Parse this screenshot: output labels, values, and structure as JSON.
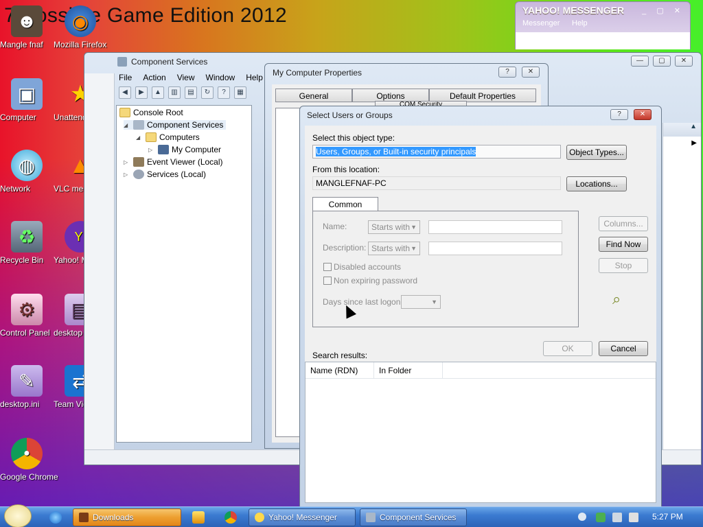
{
  "desktop": {
    "wallpaper_title": "7 Possible Game Edition 2012",
    "icons": [
      {
        "label": "Mangle fnaf",
        "icon": "mangle-icon"
      },
      {
        "label": "Mozilla Firefox",
        "icon": "firefox-icon"
      },
      {
        "label": "Computer",
        "icon": "computer-icon"
      },
      {
        "label": "Unattended Software",
        "icon": "star-icon"
      },
      {
        "label": "Network",
        "icon": "network-icon"
      },
      {
        "label": "VLC media player",
        "icon": "vlc-icon"
      },
      {
        "label": "Recycle Bin",
        "icon": "recycle-bin-icon"
      },
      {
        "label": "Yahoo! Messenger",
        "icon": "yahoo-icon"
      },
      {
        "label": "Control Panel",
        "icon": "control-panel-icon"
      },
      {
        "label": "desktop",
        "icon": "document-icon"
      },
      {
        "label": "desktop.ini",
        "icon": "settings-file-icon"
      },
      {
        "label": "Team Viewer",
        "icon": "teamviewer-icon"
      },
      {
        "label": "Google Chrome",
        "icon": "chrome-icon"
      }
    ]
  },
  "yahoo_window": {
    "title": "YAHOO! MESSENGER",
    "menu": [
      "Messenger",
      "Help"
    ]
  },
  "component_services": {
    "title": "Component Services",
    "menu": [
      "File",
      "Action",
      "View",
      "Window",
      "Help"
    ],
    "tree": [
      {
        "label": "Console Root"
      },
      {
        "label": "Component Services"
      },
      {
        "label": "Computers"
      },
      {
        "label": "My Computer"
      },
      {
        "label": "Event Viewer (Local)"
      },
      {
        "label": "Services (Local)"
      }
    ]
  },
  "my_computer_props": {
    "title": "My Computer Properties",
    "tabs": [
      "General",
      "Options",
      "Default Properties",
      "COM Security"
    ]
  },
  "select_users": {
    "title": "Select Users or Groups",
    "object_type_label": "Select this object type:",
    "object_type_value": "Users, Groups, or Built-in security principals",
    "object_types_button": "Object Types...",
    "location_label": "From this location:",
    "location_value": "MANGLEFNAF-PC",
    "locations_button": "Locations...",
    "tab": "Common Queries",
    "name_label": "Name:",
    "name_mode": "Starts with",
    "desc_label": "Description:",
    "desc_mode": "Starts with",
    "disabled_accounts": "Disabled accounts",
    "non_expiring": "Non expiring password",
    "days_label": "Days since last logon:",
    "columns_button": "Columns...",
    "find_now_button": "Find Now",
    "stop_button": "Stop",
    "ok_button": "OK",
    "cancel_button": "Cancel",
    "search_results_label": "Search results:",
    "columns": [
      "Name (RDN)",
      "In Folder"
    ]
  },
  "taskbar": {
    "items": [
      {
        "label": "Downloads",
        "active": true
      },
      {
        "label": "Yahoo! Messenger",
        "active": false
      },
      {
        "label": "Component Services",
        "active": false
      }
    ],
    "clock": "5:27 PM"
  }
}
